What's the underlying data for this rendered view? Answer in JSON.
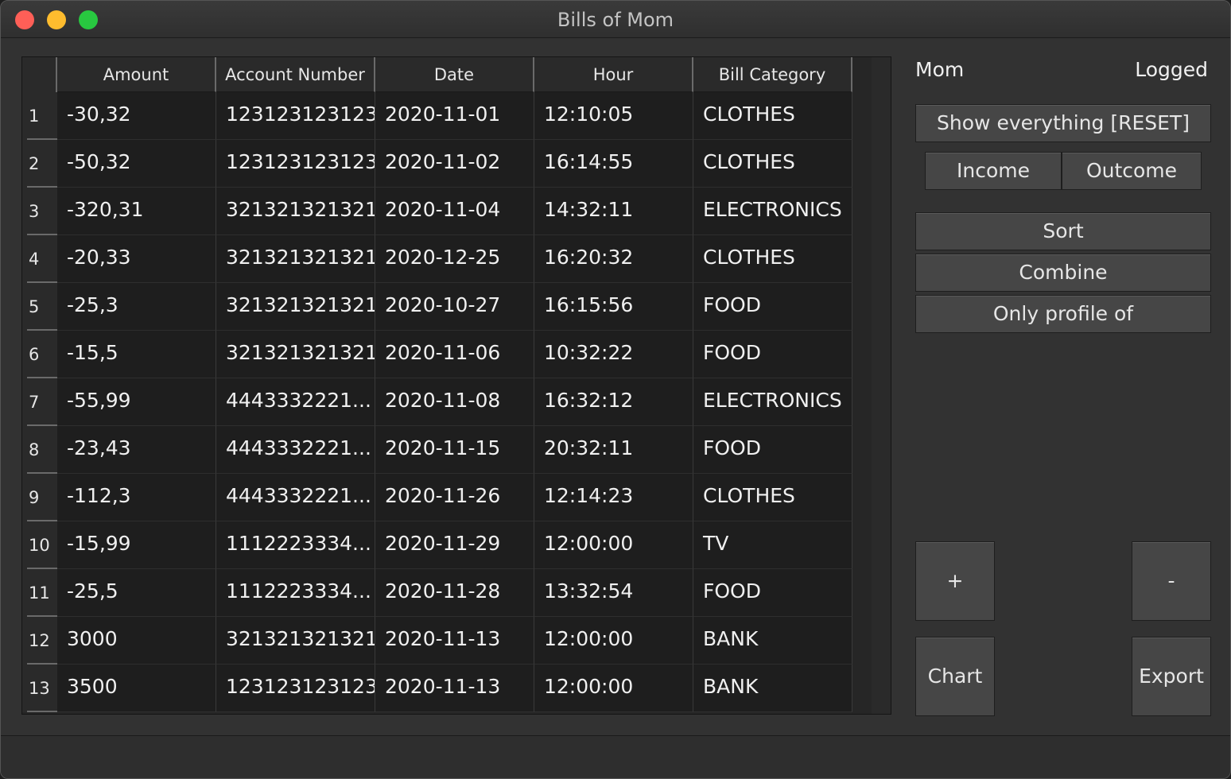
{
  "window": {
    "title": "Bills of Mom"
  },
  "table": {
    "headers": [
      "Amount",
      "Account Number",
      "Date",
      "Hour",
      "Bill Category"
    ],
    "rows": [
      {
        "num": "1",
        "amount": "-30,32",
        "account": "123123123123",
        "date": "2020-11-01",
        "hour": "12:10:05",
        "category": "CLOTHES"
      },
      {
        "num": "2",
        "amount": "-50,32",
        "account": "123123123123",
        "date": "2020-11-02",
        "hour": "16:14:55",
        "category": "CLOTHES"
      },
      {
        "num": "3",
        "amount": "-320,31",
        "account": "321321321321",
        "date": "2020-11-04",
        "hour": "14:32:11",
        "category": "ELECTRONICS"
      },
      {
        "num": "4",
        "amount": "-20,33",
        "account": "321321321321",
        "date": "2020-12-25",
        "hour": "16:20:32",
        "category": "CLOTHES"
      },
      {
        "num": "5",
        "amount": "-25,3",
        "account": "321321321321",
        "date": "2020-10-27",
        "hour": "16:15:56",
        "category": "FOOD"
      },
      {
        "num": "6",
        "amount": "-15,5",
        "account": "321321321321",
        "date": "2020-11-06",
        "hour": "10:32:22",
        "category": "FOOD"
      },
      {
        "num": "7",
        "amount": "-55,99",
        "account": "4443332221...",
        "date": "2020-11-08",
        "hour": "16:32:12",
        "category": "ELECTRONICS"
      },
      {
        "num": "8",
        "amount": "-23,43",
        "account": "4443332221...",
        "date": "2020-11-15",
        "hour": "20:32:11",
        "category": "FOOD"
      },
      {
        "num": "9",
        "amount": "-112,3",
        "account": "4443332221...",
        "date": "2020-11-26",
        "hour": "12:14:23",
        "category": "CLOTHES"
      },
      {
        "num": "10",
        "amount": "-15,99",
        "account": "1112223334...",
        "date": "2020-11-29",
        "hour": "12:00:00",
        "category": "TV"
      },
      {
        "num": "11",
        "amount": "-25,5",
        "account": "1112223334...",
        "date": "2020-11-28",
        "hour": "13:32:54",
        "category": "FOOD"
      },
      {
        "num": "12",
        "amount": "3000",
        "account": "321321321321",
        "date": "2020-11-13",
        "hour": "12:00:00",
        "category": "BANK"
      },
      {
        "num": "13",
        "amount": "3500",
        "account": "123123123123",
        "date": "2020-11-13",
        "hour": "12:00:00",
        "category": "BANK"
      }
    ]
  },
  "sidebar": {
    "user": "Mom",
    "status": "Logged",
    "show_everything": "Show everything [RESET]",
    "income": "Income",
    "outcome": "Outcome",
    "sort": "Sort",
    "combine": "Combine",
    "only_profile": "Only profile of",
    "add": "+",
    "remove": "-",
    "chart": "Chart",
    "export": "Export"
  }
}
